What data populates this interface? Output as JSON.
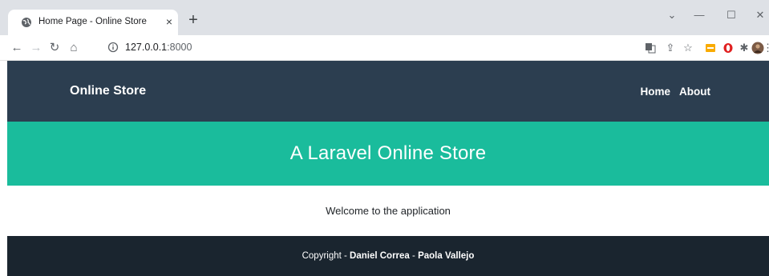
{
  "browser": {
    "tab_title": "Home Page - Online Store",
    "tab_close": "×",
    "new_tab": "+",
    "url_host": "127.0.0.1",
    "url_port": ":8000",
    "window_controls": {
      "dropdown": "⌄",
      "minimize": "—",
      "maximize": "☐",
      "close": "✕"
    },
    "icons": [
      "back-icon",
      "forward-icon",
      "reload-icon",
      "home-icon",
      "site-info-icon",
      "translate-icon",
      "share-icon",
      "bookmark-star-icon",
      "extension-yellow-icon",
      "opera-icon",
      "extensions-puzzle-icon",
      "profile-avatar-icon",
      "menu-kebab-icon"
    ]
  },
  "navbar": {
    "brand": "Online Store",
    "links": [
      {
        "label": "Home"
      },
      {
        "label": "About"
      }
    ],
    "bg_color": "#2c3e50"
  },
  "hero": {
    "title": "A Laravel Online Store",
    "bg_color": "#1abc9c"
  },
  "main": {
    "welcome": "Welcome to the application"
  },
  "footer": {
    "prefix": "Copyright - ",
    "author1": "Daniel Correa",
    "separator": " - ",
    "author2": "Paola Vallejo",
    "bg_color": "#1a252f"
  }
}
